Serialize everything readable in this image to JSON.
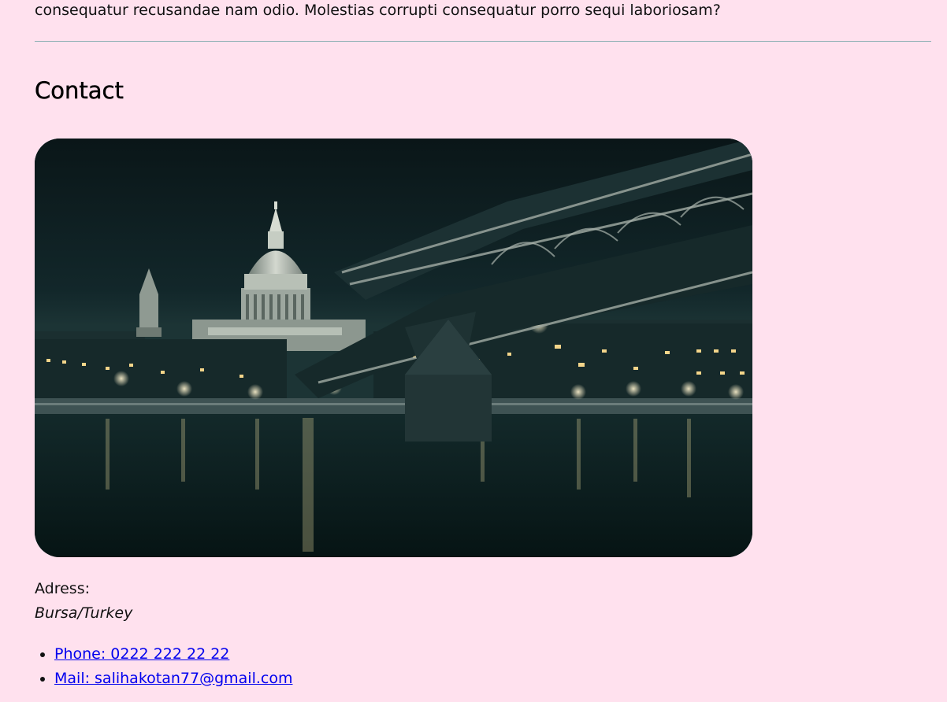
{
  "intro": {
    "text": "consequatur recusandae nam odio. Molestias corrupti consequatur porro sequi laboriosam?"
  },
  "contact": {
    "heading": "Contact",
    "image_alt": "Night view of London skyline with St Paul's Cathedral and Millennium Bridge over the Thames",
    "address_label": "Adress:",
    "address_value": "Bursa/Turkey",
    "links": [
      {
        "label": "Phone: 0222 222 22 22"
      },
      {
        "label": "Mail: salihakotan77@gmail.com"
      }
    ]
  },
  "colors": {
    "background": "#ffe1ee",
    "divider": "#8fb0b4",
    "link": "#0000ee",
    "photo_sky": "#0d1f22",
    "photo_water": "#071617"
  }
}
